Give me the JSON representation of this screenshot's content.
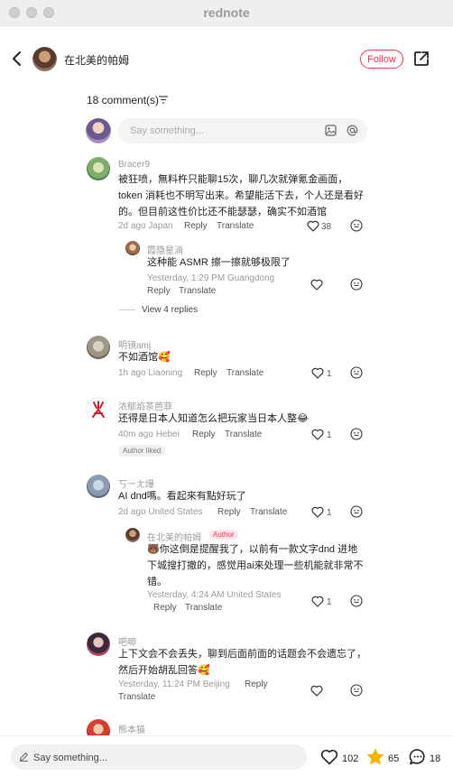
{
  "window": {
    "title": "rednote"
  },
  "header": {
    "author_name": "在北美的帕姆",
    "follow_label": "Follow"
  },
  "comments_header": {
    "count_label": "18 comment(s)"
  },
  "composer": {
    "placeholder": "Say something..."
  },
  "comments": [
    {
      "user": "Bracer9",
      "lines": [
        "被狂喷，無料杵只能聊15次，聊几次就弹氪金画面，",
        "token 消耗也不明写出来。希望能活下去，个人还是看好",
        "的。但目前这性价比还不能瑟瑟，确实不如酒馆"
      ],
      "meta": "2d ago Japan",
      "reply": "Reply",
      "translate": "Translate",
      "likes": "38",
      "reply_item": {
        "user": "霞隐星淌",
        "text": "这种能 ASMR 擦一擦就够极限了",
        "meta": "Yesterday, 1:29 PM Guangdong",
        "reply": "Reply",
        "translate": "Translate"
      },
      "view_replies": "View 4 replies"
    },
    {
      "user": "明镜amj",
      "text": "不如酒馆",
      "meta": "1h ago Liaoning",
      "reply": "Reply",
      "translate": "Translate",
      "likes": "1"
    },
    {
      "user": "浓郁焰茶芭菲",
      "text": "还得是日本人知道怎么把玩家当日本人整",
      "meta": "40m ago Hebei",
      "reply": "Reply",
      "translate": "Translate",
      "likes": "1",
      "badge": "Author liked"
    },
    {
      "user": "丂一ㄤ爆",
      "text": "AI dnd嗎。看起來有點好玩了",
      "meta": "2d ago United States",
      "reply": "Reply",
      "translate": "Translate",
      "likes": "1",
      "reply_item": {
        "user": "在北美的帕姆",
        "badge": "Author",
        "lines": [
          "你这倒是提醒我了，以前有一款文字dnd 进地",
          "下城搜打撤的，感觉用ai来处理一些机能就非常不",
          "错。"
        ],
        "meta": "Yesterday, 4:24 AM United States",
        "reply": "Reply",
        "translate": "Translate",
        "likes": "1"
      }
    },
    {
      "user": "吧唧",
      "lines": [
        "上下文会不会丢失，聊到后面前面的话题会不会遗忘了，",
        "然后开始胡乱回答"
      ],
      "meta": "Yesterday, 11:24 PM Beijing",
      "reply": "Reply",
      "translate": "Translate"
    },
    {
      "user": "熊本猫"
    }
  ],
  "bottom_bar": {
    "placeholder": "Say something...",
    "likes": "102",
    "stars": "65",
    "comments": "18"
  },
  "colors": {
    "accent": "#ff2e4d",
    "star": "#f5b400"
  }
}
